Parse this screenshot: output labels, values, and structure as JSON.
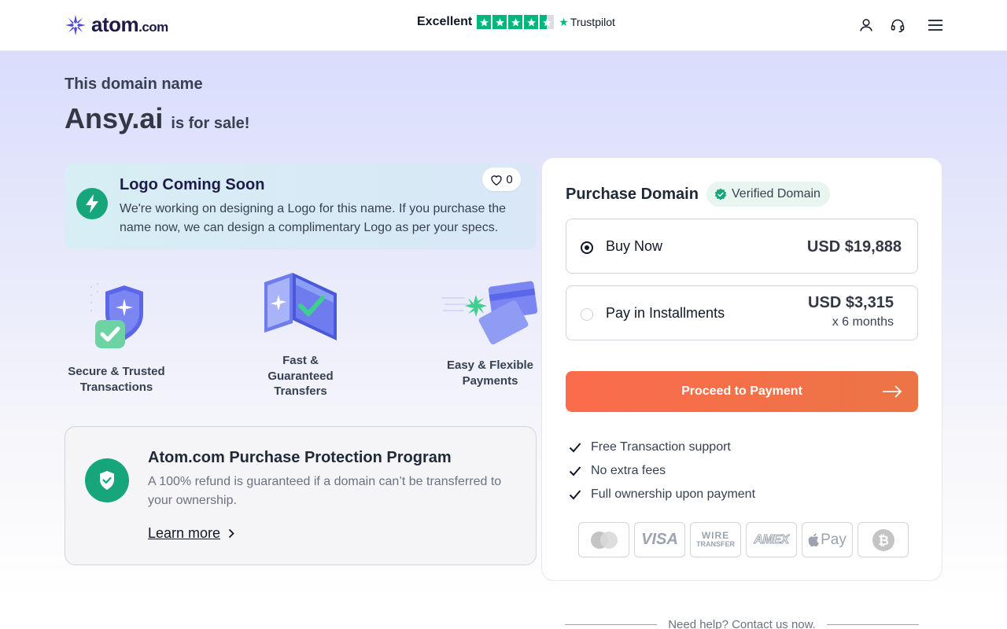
{
  "header": {
    "brand": "atom",
    "brand_tld": ".com",
    "rating_label": "Excellent",
    "rating_stars": 4.5,
    "trustpilot": "Trustpilot",
    "icons": [
      "user-icon",
      "headset-icon",
      "menu-icon"
    ]
  },
  "hero": {
    "subtitle": "This domain name",
    "domain": "Ansy.ai",
    "for_sale": "is for sale!"
  },
  "logo_card": {
    "title": "Logo Coming Soon",
    "text": "We're working on designing a Logo for this name. If you purchase the name now, we can design a complimentary Logo as per your specs.",
    "likes": "0"
  },
  "features": [
    {
      "label": "Secure & Trusted Transactions",
      "icon": "shield-check-icon"
    },
    {
      "label": "Fast & Guaranteed Transfers",
      "icon": "transfer-icon"
    },
    {
      "label": "Easy & Flexible Payments",
      "icon": "cards-icon"
    }
  ],
  "protection": {
    "title": "Atom.com Purchase Protection Program",
    "text": "A 100% refund is guaranteed if a domain can’t be transferred to your ownership.",
    "link": "Learn more"
  },
  "purchase": {
    "title": "Purchase Domain",
    "verified": "Verified Domain",
    "options": [
      {
        "label": "Buy Now",
        "price": "USD $19,888",
        "selected": true
      },
      {
        "label": "Pay in Installments",
        "price": "USD $3,315",
        "sub": "x 6 months",
        "selected": false
      }
    ],
    "cta": "Proceed to Payment",
    "benefits": [
      "Free Transaction support",
      "No extra fees",
      "Full ownership upon payment"
    ],
    "payment_methods": [
      "mastercard-icon",
      "visa-icon",
      "wire-transfer-icon",
      "amex-icon",
      "apple-pay-icon",
      "bitcoin-icon"
    ],
    "payment_labels": {
      "visa": "VISA",
      "wire_top": "WIRE",
      "wire_bottom": "TRANSFER",
      "amex": "AMEX",
      "apple": "Pay"
    }
  },
  "help": {
    "text": "Need help? Contact us now."
  },
  "colors": {
    "accent": "#fb6c4b",
    "green": "#17a67c",
    "trustpilot": "#00b67a",
    "brand": "#1e1b4b"
  }
}
